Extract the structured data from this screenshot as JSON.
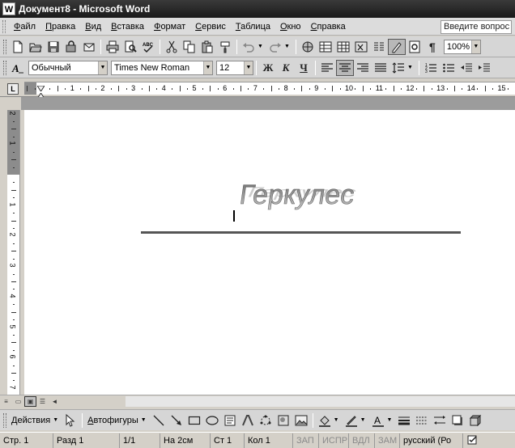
{
  "window": {
    "title": "Документ8 - Microsoft Word",
    "app_icon_letter": "W"
  },
  "menu": {
    "items": [
      "Файл",
      "Правка",
      "Вид",
      "Вставка",
      "Формат",
      "Сервис",
      "Таблица",
      "Окно",
      "Справка"
    ],
    "ask_placeholder": "Введите вопрос"
  },
  "standard_toolbar": {
    "zoom": "100%"
  },
  "formatting_toolbar": {
    "style": "Обычный",
    "font": "Times New Roman",
    "size": "12",
    "bold": "Ж",
    "italic": "К",
    "underline": "Ч"
  },
  "rulers": {
    "tab_selector": "L",
    "horizontal": [
      "1",
      "1",
      "2",
      "3",
      "4",
      "5",
      "6",
      "7",
      "8",
      "9",
      "10",
      "11",
      "12",
      "13",
      "14",
      "15"
    ],
    "vertical": [
      "2",
      "1",
      "1",
      "2",
      "3",
      "4",
      "5",
      "6",
      "7"
    ]
  },
  "document": {
    "wordart_text": "Геркулес"
  },
  "drawing_toolbar": {
    "actions": "Действия",
    "autoshapes": "Автофигуры"
  },
  "status": {
    "page": "Стр. 1",
    "section": "Разд 1",
    "pages": "1/1",
    "at": "На 2см",
    "line": "Ст 1",
    "col": "Кол 1",
    "rec": "ЗАП",
    "trk": "ИСПР",
    "ext": "ВДЛ",
    "ovr": "ЗАМ",
    "language": "русский (Ро"
  }
}
